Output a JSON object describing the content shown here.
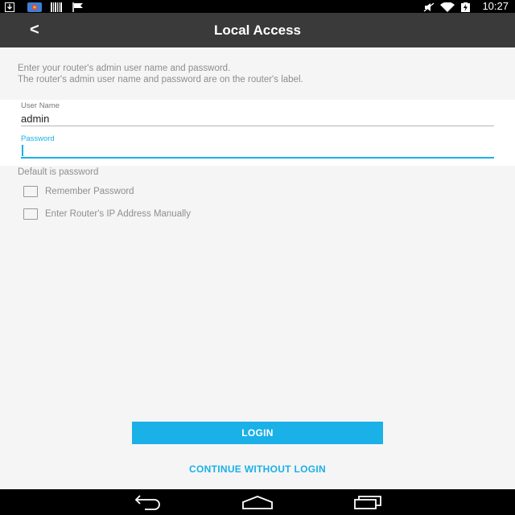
{
  "status_bar": {
    "time": "10:27",
    "left_icons": [
      "download-icon",
      "photo-app-icon",
      "barcode-icon",
      "flag-icon"
    ],
    "right_icons": [
      "mute-icon",
      "wifi-icon",
      "battery-charging-icon"
    ]
  },
  "app_bar": {
    "back_label": "<",
    "title": "Local Access"
  },
  "instructions": {
    "line1": "Enter your router's admin user name and password.",
    "line2": "The router's admin user name and password are on the router's label."
  },
  "form": {
    "username_label": "User Name",
    "username_value": "admin",
    "password_label": "Password",
    "password_value": ""
  },
  "hint": "Default is password",
  "options": {
    "remember_password": {
      "label": "Remember Password",
      "checked": false
    },
    "manual_ip": {
      "label": "Enter Router's IP Address Manually",
      "checked": false
    }
  },
  "actions": {
    "login_label": "LOGIN",
    "continue_label": "CONTINUE WITHOUT LOGIN"
  },
  "nav_bar": {
    "icons": [
      "back-nav-icon",
      "home-nav-icon",
      "recents-nav-icon"
    ]
  },
  "colors": {
    "accent": "#1ab0e8",
    "app_bar": "#3a3a3a",
    "background": "#f5f5f5"
  }
}
